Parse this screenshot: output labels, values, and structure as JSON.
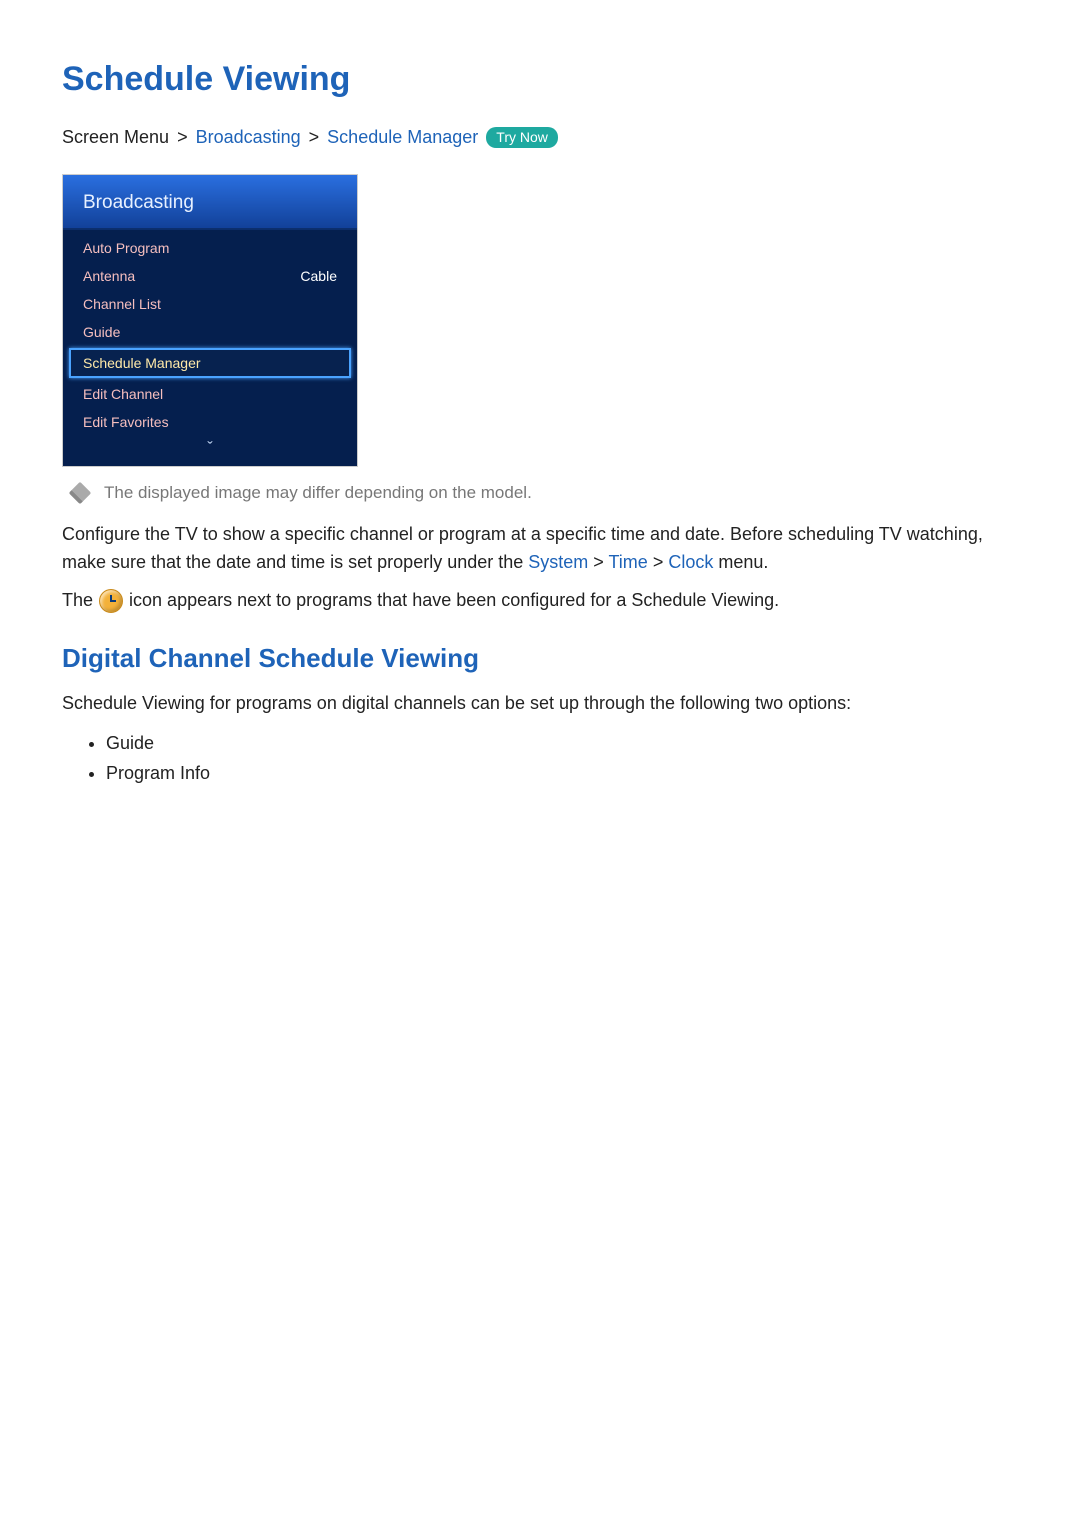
{
  "title": "Schedule Viewing",
  "breadcrumb": {
    "prefix": "Screen Menu",
    "sep": ">",
    "link1": "Broadcasting",
    "link2": "Schedule Manager",
    "trynow": "Try Now"
  },
  "tvpanel": {
    "header": "Broadcasting",
    "items": [
      {
        "label": "Auto Program",
        "value": ""
      },
      {
        "label": "Antenna",
        "value": "Cable"
      },
      {
        "label": "Channel List",
        "value": ""
      },
      {
        "label": "Guide",
        "value": ""
      },
      {
        "label": "Schedule Manager",
        "value": "",
        "selected": true
      },
      {
        "label": "Edit Channel",
        "value": ""
      },
      {
        "label": "Edit Favorites",
        "value": ""
      }
    ],
    "scroll_glyph": "ˇ"
  },
  "note": "The displayed image may differ depending on the model.",
  "para1_a": "Configure the TV to show a specific channel or program at a specific time and date. Before scheduling TV watching, make sure that the date and time is set properly under the ",
  "para1_link_system": "System",
  "para1_sep1": " > ",
  "para1_link_time": "Time",
  "para1_sep2": " > ",
  "para1_link_clock": "Clock",
  "para1_b": " menu.",
  "para2_a": "The ",
  "para2_b": " icon appears next to programs that have been configured for a Schedule Viewing.",
  "subtitle": "Digital Channel Schedule Viewing",
  "para3": "Schedule Viewing for programs on digital channels can be set up through the following two options:",
  "bullets": [
    "Guide",
    "Program Info"
  ]
}
